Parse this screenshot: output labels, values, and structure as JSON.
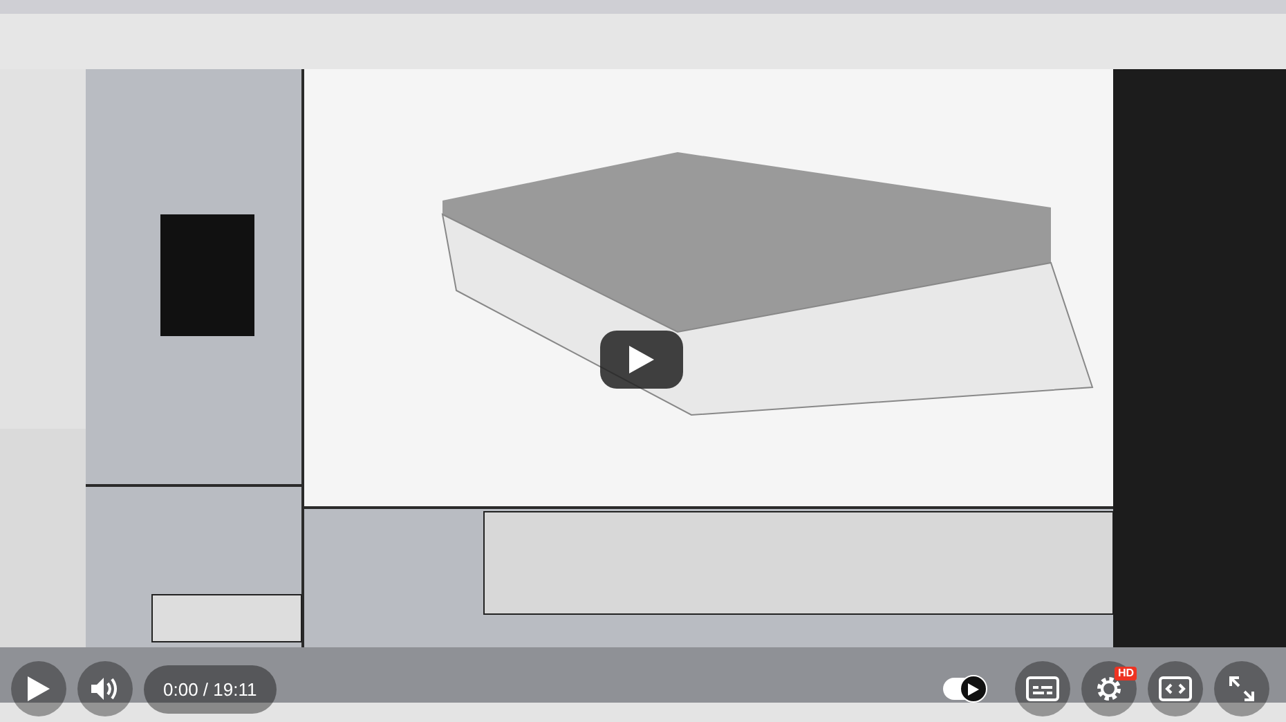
{
  "player": {
    "time": "0:00 / 19:11",
    "hd_badge": "HD",
    "autoplay": {
      "on": true
    }
  }
}
